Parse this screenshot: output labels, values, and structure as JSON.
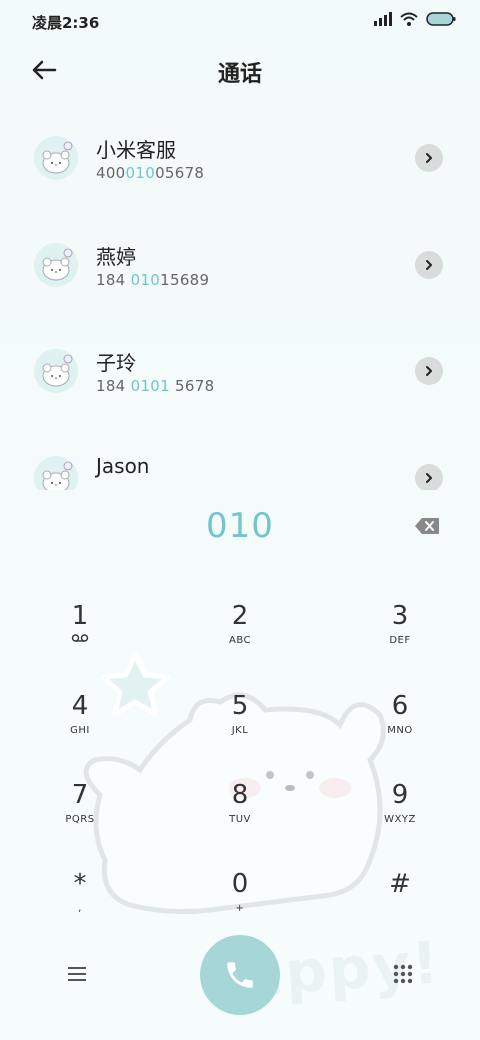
{
  "status_bar": {
    "time": "凌晨2:36",
    "icons": [
      "signal-icon",
      "wifi-icon",
      "battery-icon"
    ],
    "battery_color": "#a6d6d8"
  },
  "header": {
    "title": "通话",
    "back_icon": "back-arrow-icon"
  },
  "results": [
    {
      "name": "小米客服",
      "number_parts": [
        "400",
        "010",
        "05678"
      ]
    },
    {
      "name": "燕婷",
      "number_parts": [
        "184 ",
        "010",
        "15689"
      ]
    },
    {
      "name": "子玲",
      "number_parts": [
        "184 ",
        "0101",
        " 5678"
      ]
    },
    {
      "name": "Jason",
      "number_parts": [
        "",
        "",
        ""
      ]
    }
  ],
  "dialed_number": "010",
  "keypad": [
    {
      "digit": "1",
      "sub": "voicemail-icon"
    },
    {
      "digit": "2",
      "sub": "ABC"
    },
    {
      "digit": "3",
      "sub": "DEF"
    },
    {
      "digit": "4",
      "sub": "GHI"
    },
    {
      "digit": "5",
      "sub": "JKL"
    },
    {
      "digit": "6",
      "sub": "MNO"
    },
    {
      "digit": "7",
      "sub": "PQRS"
    },
    {
      "digit": "8",
      "sub": "TUV"
    },
    {
      "digit": "9",
      "sub": "WXYZ"
    },
    {
      "digit": "*",
      "sub": ","
    },
    {
      "digit": "0",
      "sub": "+"
    },
    {
      "digit": "#",
      "sub": ""
    }
  ],
  "colors": {
    "accent": "#6fc7cc",
    "call_button": "#a6d6d8",
    "detail_button": "#dadcdc"
  },
  "bottom_bar": {
    "menu_icon": "menu-icon",
    "call_icon": "phone-icon",
    "dialpad_icon": "dialpad-icon"
  },
  "background_text": "appy!"
}
